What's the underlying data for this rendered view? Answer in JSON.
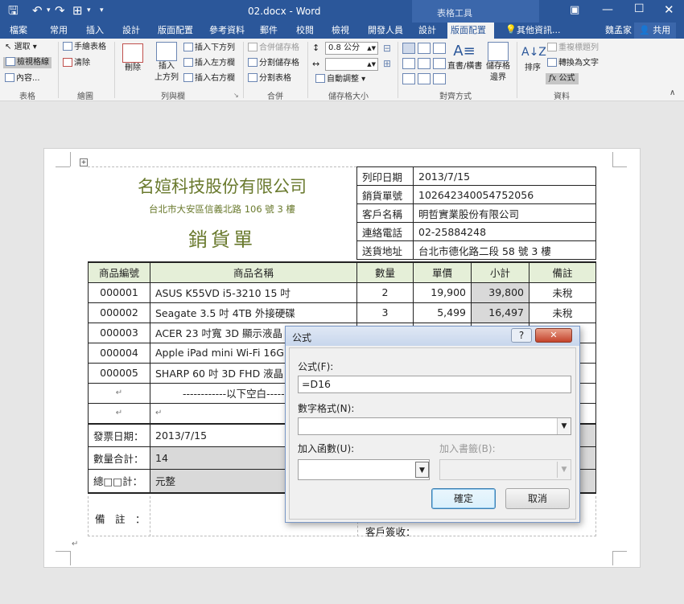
{
  "window": {
    "title": "02.docx - Word",
    "context_group": "表格工具",
    "user": "魏孟家",
    "share": "共用",
    "tell_me": "其他資訊..."
  },
  "tabs": [
    "檔案",
    "常用",
    "插入",
    "設計",
    "版面配置",
    "參考資料",
    "郵件",
    "校閱",
    "檢視",
    "開發人員",
    "設計",
    "版面配置"
  ],
  "active_tab_index": 11,
  "ribbon": {
    "table": {
      "select": "選取",
      "gridlines": "檢視格線",
      "props": "內容...",
      "group": "表格"
    },
    "draw": {
      "draw_table": "手繪表格",
      "eraser": "清除",
      "group": "繪圖"
    },
    "rows_cols": {
      "delete": "刪除",
      "insert_above_1": "插入",
      "insert_above_2": "上方列",
      "insert_below": "插入下方列",
      "insert_left": "插入左方欄",
      "insert_right": "插入右方欄",
      "group": "列與欄"
    },
    "merge": {
      "merge_cells": "合併儲存格",
      "split_cells": "分割儲存格",
      "split_table": "分割表格",
      "group": "合併"
    },
    "cell_size": {
      "height": "0.8 公分",
      "width": "",
      "autofit": "自動調整",
      "group": "儲存格大小"
    },
    "alignment": {
      "text_dir": "直書/橫書",
      "margins_1": "儲存格",
      "margins_2": "邊界",
      "group": "對齊方式"
    },
    "data": {
      "sort": "排序",
      "repeat_header": "重複標題列",
      "to_text": "轉換為文字",
      "formula": "公式",
      "group": "資料"
    }
  },
  "doc": {
    "company": "名媗科技股份有限公司",
    "address": "台北市大安區信義北路 106 號 3 樓",
    "doc_title": "銷貨單",
    "info": [
      [
        "列印日期",
        "2013/7/15"
      ],
      [
        "銷貨單號",
        "102642340054752056"
      ],
      [
        "客戶名稱",
        "明哲實業股份有限公司"
      ],
      [
        "連絡電話",
        "02-25884248"
      ],
      [
        "送貨地址",
        "台北市德化路二段 58 號 3 樓"
      ]
    ],
    "headers": [
      "商品編號",
      "商品名稱",
      "數量",
      "單價",
      "小計",
      "備註"
    ],
    "items": [
      [
        "000001",
        "ASUS K55VD i5-3210 15 吋",
        "2",
        "19,900",
        "39,800",
        "未稅"
      ],
      [
        "000002",
        "Seagate 3.5 吋 4TB 外接硬碟",
        "3",
        "5,499",
        "16,497",
        "未稅"
      ],
      [
        "000003",
        "ACER 23 吋寬 3D 顯示液晶",
        "",
        "",
        "",
        ""
      ],
      [
        "000004",
        "Apple iPad mini Wi-Fi 16GB",
        "",
        "",
        "",
        ""
      ],
      [
        "000005",
        "SHARP 60 吋 3D FHD 液晶",
        "",
        "",
        "",
        ""
      ]
    ],
    "blank_note": "------------以下空白------------",
    "invoice_date_label": "發票日期：",
    "invoice_date": "2013/7/15",
    "qty_total_label": "數量合計：",
    "qty_total": "14",
    "sum_label": "總□□計：",
    "sum_value": "元整",
    "remarks_label": "備　註　：",
    "customer_sign": "客戶簽收："
  },
  "dialog": {
    "title": "公式",
    "help": "?",
    "close": "✕",
    "formula_label": "公式(F):",
    "formula_value": "=D16",
    "number_format_label": "數字格式(N):",
    "number_format_value": "",
    "paste_function_label": "加入函數(U):",
    "paste_function_value": "",
    "paste_bookmark_label": "加入書籤(B):",
    "paste_bookmark_value": "",
    "ok": "確定",
    "cancel": "取消"
  }
}
